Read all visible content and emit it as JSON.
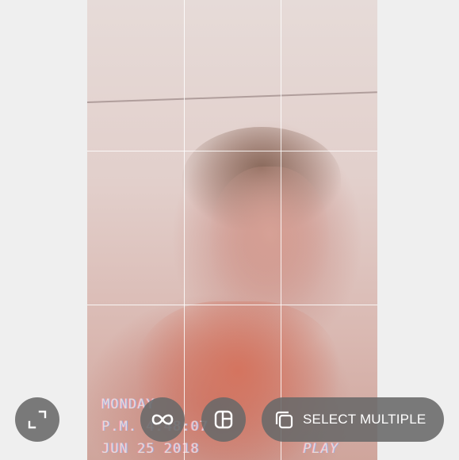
{
  "photo": {
    "timestamp_day": "MONDAY",
    "timestamp_time": "P.M. 4:48:07",
    "timestamp_date": "JUN 25 2018",
    "overlay_label": "PLAY"
  },
  "toolbar": {
    "expand_icon": "expand-icon",
    "boomerang_icon": "infinity-icon",
    "layout_icon": "layout-grid-icon",
    "select_multiple_icon": "stacked-squares-icon",
    "select_multiple_label": "SELECT MULTIPLE"
  },
  "colors": {
    "background": "#efefef",
    "button_fill": "#696969",
    "icon_color": "#ffffff",
    "grid_lines": "#ffffff"
  }
}
